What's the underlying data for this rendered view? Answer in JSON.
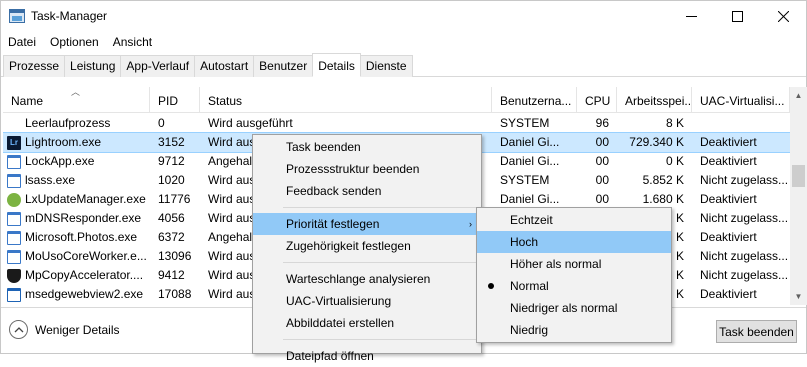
{
  "window": {
    "title": "Task-Manager"
  },
  "menu": [
    "Datei",
    "Optionen",
    "Ansicht"
  ],
  "tabs": [
    "Prozesse",
    "Leistung",
    "App-Verlauf",
    "Autostart",
    "Benutzer",
    "Details",
    "Dienste"
  ],
  "active_tab": "Details",
  "columns": [
    "Name",
    "PID",
    "Status",
    "Benutzerna...",
    "CPU",
    "Arbeitsspei...",
    "UAC-Virtualisi..."
  ],
  "rows": [
    {
      "name": "Leerlaufprozess",
      "pid": "0",
      "status": "Wird ausgeführt",
      "user": "SYSTEM",
      "cpu": "96",
      "mem": "8 K",
      "uac": "",
      "icon": "blank-icon",
      "color": "#ffffff"
    },
    {
      "name": "Lightroom.exe",
      "pid": "3152",
      "status": "Wird ausg",
      "user": "Daniel Gi...",
      "cpu": "00",
      "mem": "729.340 K",
      "uac": "Deaktiviert",
      "icon": "lightroom-icon",
      "color": "#0a1a33",
      "selected": true
    },
    {
      "name": "LockApp.exe",
      "pid": "9712",
      "status": "Angehalt",
      "user": "Daniel Gi...",
      "cpu": "00",
      "mem": "0 K",
      "uac": "Deaktiviert",
      "icon": "window-icon",
      "color": "#3a78c8"
    },
    {
      "name": "lsass.exe",
      "pid": "1020",
      "status": "Wird ausg",
      "user": "SYSTEM",
      "cpu": "00",
      "mem": "5.852 K",
      "uac": "Nicht zugelass...",
      "icon": "window-icon",
      "color": "#3a78c8"
    },
    {
      "name": "LxUpdateManager.exe",
      "pid": "11776",
      "status": "Wird ausg",
      "user": "Daniel Gi...",
      "cpu": "00",
      "mem": "1.680 K",
      "uac": "Deaktiviert",
      "icon": "update-icon",
      "color": "#7cb342"
    },
    {
      "name": "mDNSResponder.exe",
      "pid": "4056",
      "status": "Wird ausg",
      "user": "",
      "cpu": "",
      "mem": "K",
      "uac": "Nicht zugelass...",
      "icon": "window-icon",
      "color": "#3a78c8"
    },
    {
      "name": "Microsoft.Photos.exe",
      "pid": "6372",
      "status": "Angehalt",
      "user": "",
      "cpu": "",
      "mem": "K",
      "uac": "Deaktiviert",
      "icon": "window-icon",
      "color": "#3a78c8"
    },
    {
      "name": "MoUsoCoreWorker.e...",
      "pid": "13096",
      "status": "Wird ausg",
      "user": "",
      "cpu": "",
      "mem": "K",
      "uac": "Nicht zugelass...",
      "icon": "window-icon",
      "color": "#3a78c8"
    },
    {
      "name": "MpCopyAccelerator....",
      "pid": "9412",
      "status": "Wird ausg",
      "user": "",
      "cpu": "",
      "mem": "K",
      "uac": "Nicht zugelass...",
      "icon": "shield-icon",
      "color": "#1a1a1a"
    },
    {
      "name": "msedgewebview2.exe",
      "pid": "17088",
      "status": "Wird ausg",
      "user": "",
      "cpu": "",
      "mem": "K",
      "uac": "Deaktiviert",
      "icon": "window-icon",
      "color": "#1e63b5"
    }
  ],
  "context_menu": {
    "items": [
      "Task beenden",
      "Prozessstruktur beenden",
      "Feedback senden",
      "Priorität festlegen",
      "Zugehörigkeit festlegen",
      "Warteschlange analysieren",
      "UAC-Virtualisierung",
      "Abbilddatei erstellen",
      "Dateipfad öffnen"
    ]
  },
  "priority_menu": {
    "items": [
      "Echtzeit",
      "Hoch",
      "Höher als normal",
      "Normal",
      "Niedriger als normal",
      "Niedrig"
    ],
    "highlighted": "Hoch",
    "checked": "Normal"
  },
  "footer": {
    "less_details": "Weniger Details",
    "end_task": "Task beenden"
  }
}
